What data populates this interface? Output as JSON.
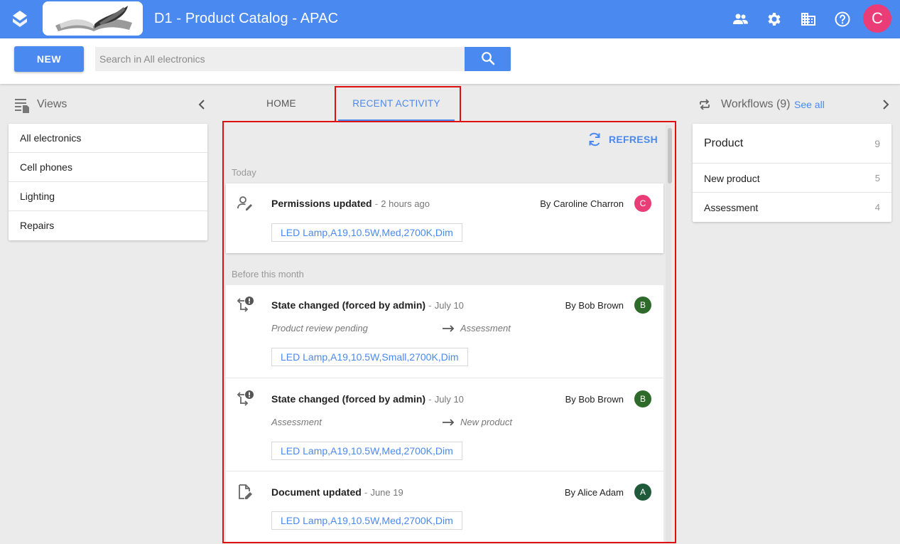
{
  "header": {
    "title": "D1 - Product Catalog - APAC",
    "user_initial": "C",
    "icons": [
      "app-logo-icon",
      "users-icon",
      "gear-icon",
      "building-icon",
      "help-icon"
    ]
  },
  "toolbar": {
    "new_label": "NEW",
    "search_placeholder": "Search in All electronics",
    "search_value": ""
  },
  "views": {
    "title": "Views",
    "items": [
      {
        "label": "All electronics"
      },
      {
        "label": "Cell phones"
      },
      {
        "label": "Lighting"
      },
      {
        "label": "Repairs"
      }
    ]
  },
  "tabs": [
    {
      "label": "HOME",
      "active": false
    },
    {
      "label": "RECENT ACTIVITY",
      "active": true
    }
  ],
  "activity": {
    "refresh_label": "REFRESH",
    "sections": [
      {
        "label": "Today",
        "entries": [
          {
            "icon": "permissions-icon",
            "title": "Permissions updated",
            "date": "2 hours ago",
            "by": "By Caroline Charron",
            "avatar": "C",
            "avatar_color": "#ea3d78",
            "document": "LED Lamp,A19,10.5W,Med,2700K,Dim"
          }
        ]
      },
      {
        "label": "Before this month",
        "entries": [
          {
            "icon": "state-change-icon",
            "title": "State changed (forced by admin)",
            "date": "July 10",
            "by": "By Bob Brown",
            "avatar": "B",
            "avatar_color": "#2e6b2a",
            "from_state": "Product review pending",
            "to_state": "Assessment",
            "document": "LED Lamp,A19,10.5W,Small,2700K,Dim"
          },
          {
            "icon": "state-change-icon",
            "title": "State changed (forced by admin)",
            "date": "July 10",
            "by": "By Bob Brown",
            "avatar": "B",
            "avatar_color": "#2e6b2a",
            "from_state": "Assessment",
            "to_state": "New product",
            "document": "LED Lamp,A19,10.5W,Med,2700K,Dim"
          },
          {
            "icon": "document-edit-icon",
            "title": "Document updated",
            "date": "June 19",
            "by": "By Alice Adam",
            "avatar": "A",
            "avatar_color": "#1f5a3b",
            "document": "LED Lamp,A19,10.5W,Med,2700K,Dim"
          }
        ]
      }
    ]
  },
  "workflows": {
    "title": "Workflows (9)",
    "see_all": "See all",
    "header": {
      "name": "Product",
      "count": "9"
    },
    "items": [
      {
        "name": "New product",
        "count": "5"
      },
      {
        "name": "Assessment",
        "count": "4"
      }
    ]
  },
  "colors": {
    "primary": "#4a89f0",
    "highlight": "#e01010",
    "user_avatar": "#ea3d78"
  }
}
